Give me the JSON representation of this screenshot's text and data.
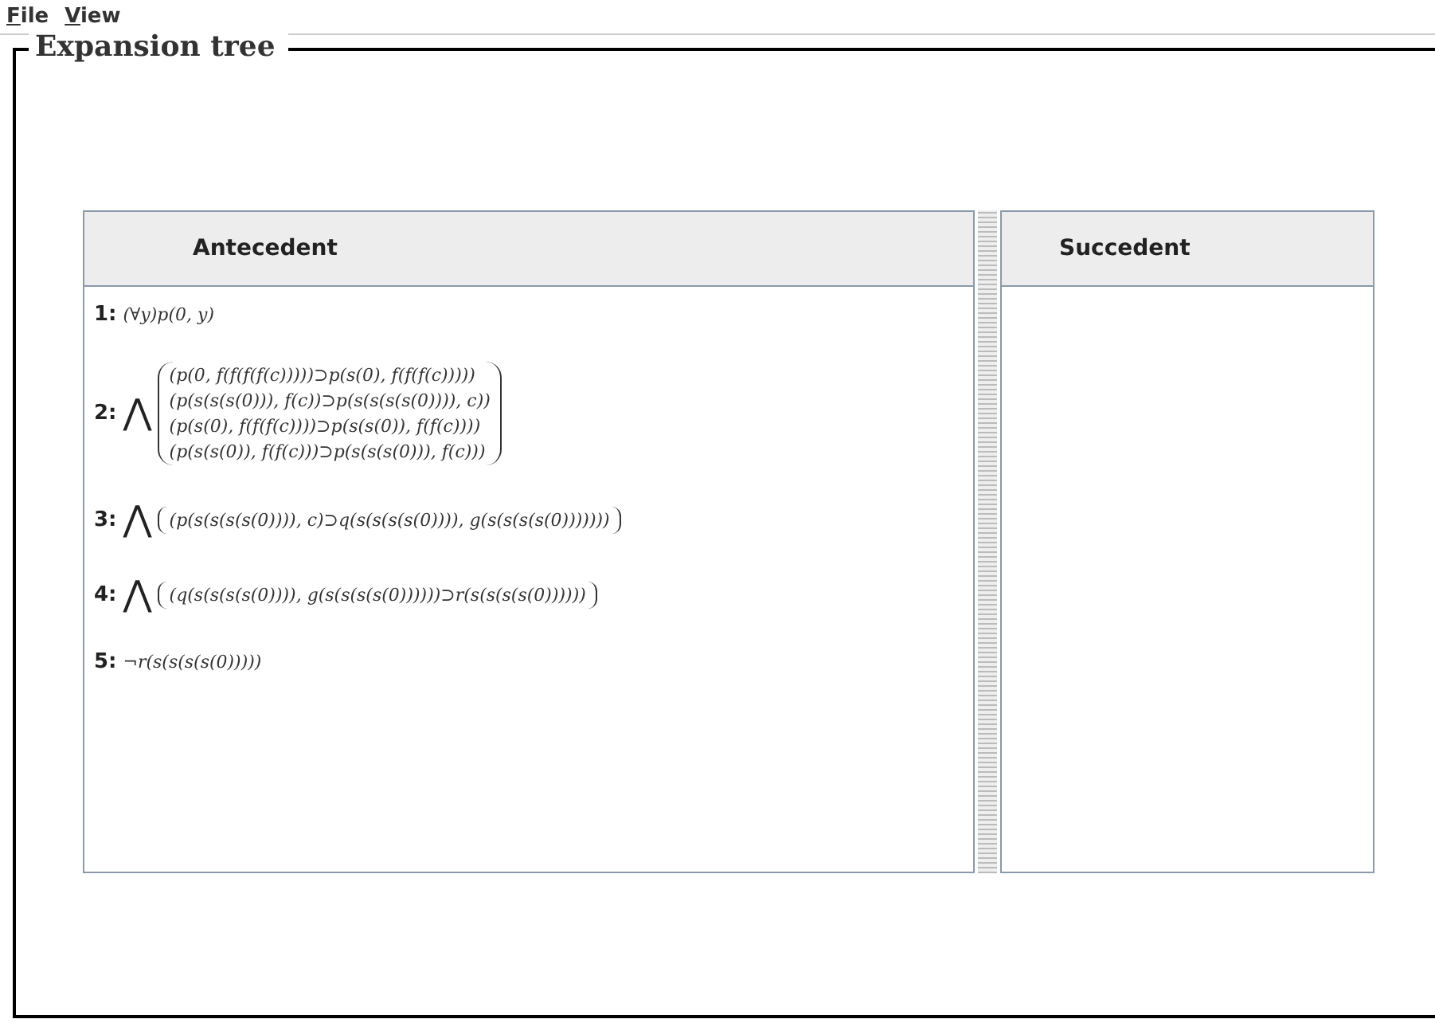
{
  "menu": [
    {
      "label": "File"
    },
    {
      "label": "View"
    }
  ],
  "panel": {
    "title": "Expansion tree"
  },
  "antecedent": {
    "header": "Antecedent",
    "entries": [
      {
        "number": "1:",
        "kind": "formula",
        "text": "(∀y)p(0, y)"
      },
      {
        "number": "2:",
        "kind": "conjunction",
        "connective": "⋀",
        "terms": [
          "(p(0, f(f(f(f(c)))))⊃p(s(0), f(f(f(c)))))",
          "(p(s(s(s(0))), f(c))⊃p(s(s(s(s(0)))), c))",
          "(p(s(0), f(f(f(c))))⊃p(s(s(0)), f(f(c))))",
          "(p(s(s(0)), f(f(c)))⊃p(s(s(s(0))), f(c)))"
        ]
      },
      {
        "number": "3:",
        "kind": "conjunction",
        "connective": "⋀",
        "terms": [
          "(p(s(s(s(s(0)))), c)⊃q(s(s(s(s(0)))), g(s(s(s(s(0)))))))"
        ]
      },
      {
        "number": "4:",
        "kind": "conjunction",
        "connective": "⋀",
        "terms": [
          "(q(s(s(s(s(0)))), g(s(s(s(s(0))))))⊃r(s(s(s(s(0))))))"
        ]
      },
      {
        "number": "5:",
        "kind": "formula",
        "text": "¬r(s(s(s(s(0)))))"
      }
    ]
  },
  "succedent": {
    "header": "Succedent"
  }
}
